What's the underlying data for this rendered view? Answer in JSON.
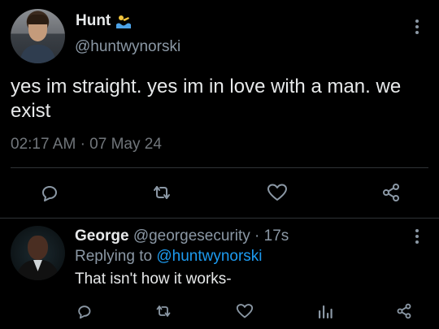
{
  "main_tweet": {
    "author": {
      "display_name": "Hunt",
      "emoji": "swimmer-emoji",
      "handle": "@huntwynorski"
    },
    "text": "yes im straight. yes im in love with a man. we exist",
    "time": "02:17 AM",
    "separator": "·",
    "date": "07 May 24",
    "actions": [
      "reply-icon",
      "retweet-icon",
      "like-icon",
      "share-icon"
    ]
  },
  "reply": {
    "author": {
      "display_name": "George",
      "handle": "@georgesecurity",
      "separator": "·",
      "time": "17s"
    },
    "replying_prefix": "Replying to",
    "replying_handle": "@huntwynorski",
    "text": "That isn't how it works-",
    "actions": [
      "reply-icon",
      "retweet-icon",
      "like-icon",
      "views-icon",
      "share-icon"
    ]
  },
  "colors": {
    "background": "#000000",
    "text": "#e7e9ea",
    "muted": "#8b98a5",
    "link": "#1d9bf0",
    "divider": "#2f3336"
  }
}
